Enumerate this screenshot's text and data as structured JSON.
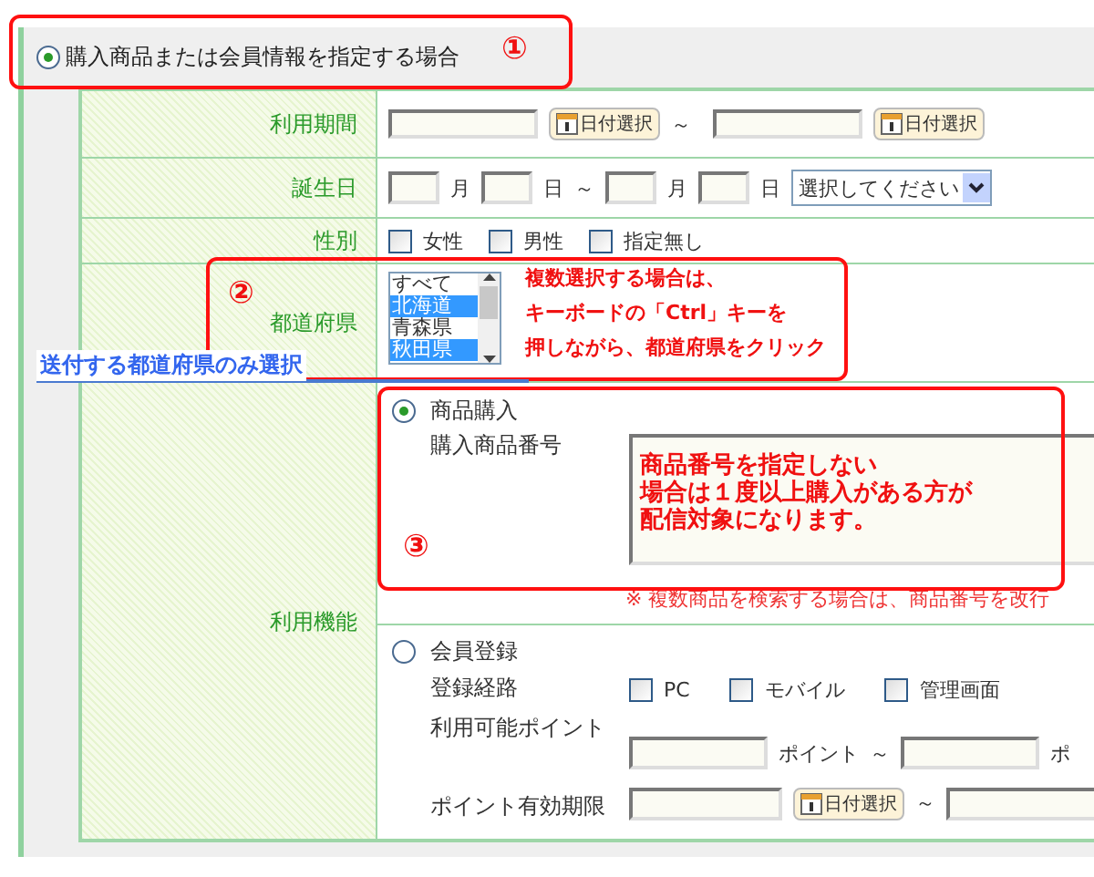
{
  "header": {
    "label": "購入商品または会員情報を指定する場合",
    "selected": true
  },
  "rows": [
    {
      "kind": "date_range",
      "label": "利用期間",
      "buttons": [
        "日付選択",
        "日付選択"
      ],
      "separator": "～"
    },
    {
      "kind": "birthday",
      "label": "誕生日",
      "units": [
        "月",
        "日",
        "月",
        "日"
      ],
      "separator": "～",
      "select": {
        "value": "選択してください"
      }
    },
    {
      "kind": "checkboxes",
      "label": "性別",
      "options": [
        {
          "label": "女性",
          "checked": false
        },
        {
          "label": "男性",
          "checked": false
        },
        {
          "label": "指定無し",
          "checked": false
        }
      ]
    },
    {
      "kind": "listbox",
      "label": "都道府県",
      "options": [
        {
          "label": "すべて",
          "selected": false
        },
        {
          "label": "北海道",
          "selected": true
        },
        {
          "label": "青森県",
          "selected": false
        },
        {
          "label": "秋田県",
          "selected": true
        }
      ]
    },
    {
      "kind": "functions",
      "label": "利用機能",
      "sections": [
        {
          "kind": "purchase",
          "label": "商品購入",
          "selected": true,
          "field_label": "購入商品番号",
          "note": "※ 複数商品を検索する場合は、商品番号を改行"
        },
        {
          "kind": "member",
          "label": "会員登録",
          "selected": false,
          "route_label": "登録経路",
          "routes": [
            {
              "label": "PC",
              "checked": false
            },
            {
              "label": "モバイル",
              "checked": false
            },
            {
              "label": "管理画面",
              "checked": false
            }
          ],
          "points_label": "利用可能ポイント",
          "points_unit": "ポイント",
          "separator": "～",
          "points_unit_end": "ポ",
          "expiry_label": "ポイント有効期限",
          "button": "日付選択"
        }
      ]
    }
  ],
  "annotations": [
    {
      "number": "①"
    },
    {
      "number": "②",
      "lines": [
        "複数選択する場合は、",
        "キーボードの「Ctrl」キーを",
        "押しながら、都道府県をクリック"
      ]
    },
    {
      "number": "③",
      "lines": [
        "商品番号を指定しない",
        "場合は１度以上購入がある方が",
        "配信対象になります。"
      ]
    }
  ],
  "side_note": "送付する都道府県のみ選択"
}
